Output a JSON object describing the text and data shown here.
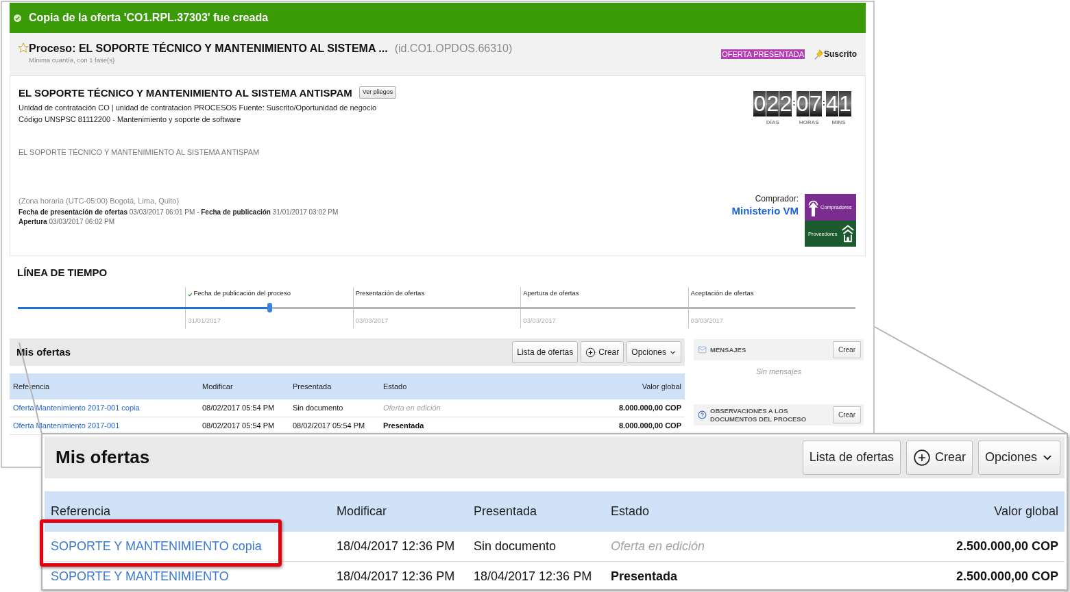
{
  "notification": {
    "text": "Copia de la oferta 'CO1.RPL.37303' fue creada"
  },
  "process": {
    "starred": false,
    "title": "Proceso: EL SOPORTE TÉCNICO Y MANTENIMIENTO AL SISTEMA ...",
    "id": "(id.CO1.OPDOS.66310)",
    "subtitle": "Mínima cuantía, con 1 fase(s)",
    "status_badge": "OFERTA PRESENTADA",
    "subscription": "Suscrito"
  },
  "summary": {
    "title": "EL SOPORTE TÉCNICO Y MANTENIMIENTO AL SISTEMA ANTISPAM",
    "documents_button": "Ver pliegos",
    "details": [
      "Unidad de contratación CO | unidad de contratacion PROCESOS Fuente: Suscrito/Oportunidad de negocio",
      "Código UNSPSC 81112200 - Mantenimiento y soporte de software"
    ],
    "description": "EL SOPORTE TÉCNICO Y MANTENIMIENTO AL SISTEMA ANTISPAM",
    "timezone": "(Zona horaria (UTC-05:00) Bogotá, Lima, Quito)",
    "dates": [
      "**Fecha de presentación de ofertas** 03/03/2017 06:01 PM - **Fecha de publicación** 31/01/2017 03:02 PM",
      "**Apertura** 03/03/2017 06:02 PM"
    ]
  },
  "countdown": {
    "units": [
      {
        "value": "022",
        "label": "DÍAS"
      },
      {
        "value": "07",
        "label": "HORAS",
        "separator": ":"
      },
      {
        "value": "41",
        "label": "MINS",
        "separator": ":"
      }
    ]
  },
  "buyer": {
    "label": "Comprador:",
    "name": "Ministerio VM",
    "logo": {
      "top_text": "Compradores",
      "bottom_text": "Proveedores"
    }
  },
  "timeline": {
    "title": "LÍNEA DE TIEMPO",
    "level": 0.3,
    "steps": [
      {
        "label": "Fecha de publicación del proceso",
        "date": "31/01/2017",
        "done": true
      },
      {
        "label": "Presentación de ofertas",
        "date": "03/03/2017",
        "done": false
      },
      {
        "label": "Apertura de ofertas",
        "date": "03/03/2017",
        "done": false
      },
      {
        "label": "Aceptación de ofertas",
        "date": "03/03/2017",
        "done": false
      }
    ]
  },
  "offers": {
    "title": "Mis ofertas",
    "buttons": [
      {
        "kind": "plain",
        "label": "Lista de ofertas"
      },
      {
        "kind": "add",
        "label": "Crear"
      },
      {
        "kind": "menu",
        "label": "Opciones"
      }
    ],
    "columns": [
      "Referencia",
      "Modificar",
      "Presentada",
      "Estado",
      "Valor global"
    ],
    "rows": [
      {
        "kind": "draft",
        "reference": "Oferta Mantenimiento 2017-001 copia",
        "modified": "08/02/2017 05:54 PM",
        "presented": "Sin documento",
        "status": "Oferta en edición",
        "value": "8.000.000,00 COP"
      },
      {
        "kind": "submitted",
        "reference": "Oferta Mantenimiento 2017-001",
        "modified": "08/02/2017 05:54 PM",
        "presented": "08/02/2017 05:54 PM",
        "status": "Presentada",
        "value": "8.000.000,00 COP"
      }
    ]
  },
  "side_panels": [
    {
      "kind": "messages",
      "title": "MENSAJES",
      "button": "Crear",
      "empty_text": "Sin mensajes"
    },
    {
      "kind": "observations",
      "title": "OBSERVACIONES A LOS DOCUMENTOS DEL PROCESO",
      "button": "Crear"
    }
  ],
  "zoom_inset": {
    "title": "Mis ofertas",
    "buttons": [
      {
        "kind": "plain",
        "label": "Lista de ofertas"
      },
      {
        "kind": "add",
        "label": "Crear"
      },
      {
        "kind": "menu",
        "label": "Opciones"
      }
    ],
    "columns": [
      "Referencia",
      "Modificar",
      "Presentada",
      "Estado",
      "Valor global"
    ],
    "rows": [
      {
        "kind": "draft",
        "reference": "SOPORTE Y MANTENIMIENTO copia",
        "modified": "18/04/2017 12:36 PM",
        "presented": "Sin documento",
        "status": "Oferta en edición",
        "value": "2.500.000,00 COP",
        "highlighted": true
      },
      {
        "kind": "submitted",
        "reference": "SOPORTE Y MANTENIMIENTO",
        "modified": "18/04/2017 12:36 PM",
        "presented": "18/04/2017 12:36 PM",
        "status": "Presentada",
        "value": "2.500.000,00 COP",
        "highlighted": false
      }
    ]
  }
}
